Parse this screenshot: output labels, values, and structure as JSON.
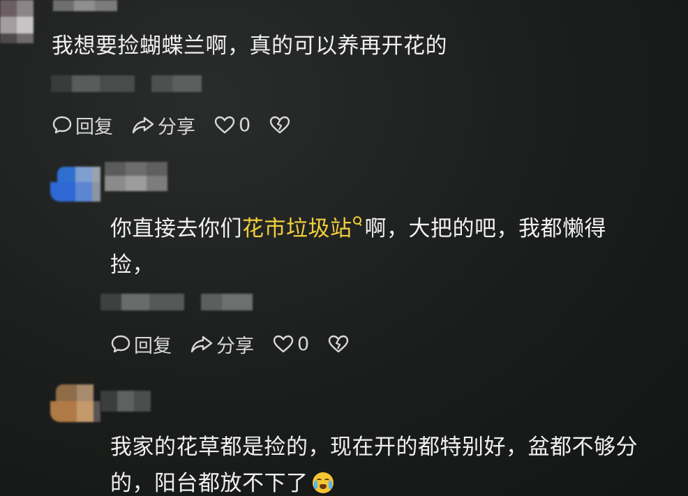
{
  "comments": [
    {
      "text": "我想要捡蝴蝶兰啊，真的可以养再开花的",
      "reply_label": "回复",
      "share_label": "分享",
      "like_count": "0"
    },
    {
      "text_before_link": "你直接去你们",
      "link_text": "花市垃圾站",
      "text_after_link": "啊，大把的吧，我都懒得",
      "text_line2": "捡，",
      "reply_label": "回复",
      "share_label": "分享",
      "like_count": "0"
    },
    {
      "text_line1": "我家的花草都是捡的，现在开的都特别好，盆都不够分",
      "text_line2": "的，阳台都放不下了"
    }
  ],
  "icons": {
    "comment": "speech-bubble-icon",
    "share": "share-arrow-icon",
    "like": "heart-icon",
    "dislike": "broken-heart-icon",
    "emoji": "crying-laughing-emoji-icon",
    "search": "search-icon"
  },
  "colors": {
    "background": "#1b1d1c",
    "text": "#f0f0f0",
    "link": "#f2cf3a",
    "action": "#d8d8d8"
  }
}
